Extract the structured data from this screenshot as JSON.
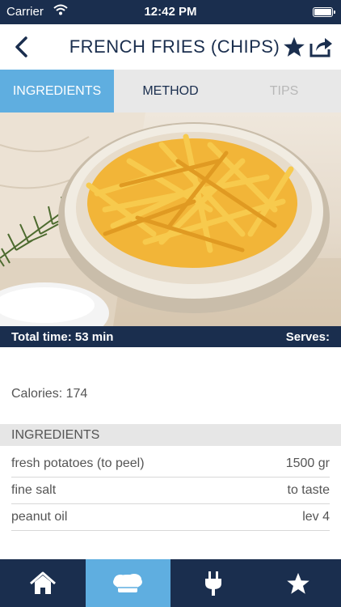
{
  "status": {
    "carrier": "Carrier",
    "time": "12:42 PM"
  },
  "nav": {
    "title": "FRENCH FRIES (CHIPS)"
  },
  "tabs": {
    "ingredients": "INGREDIENTS",
    "method": "METHOD",
    "tips": "TIPS"
  },
  "summary": {
    "total_time": "Total time: 53 min",
    "serves": "Serves:",
    "calories": "Calories: 174"
  },
  "ingredients_section": {
    "title": "INGREDIENTS",
    "items": [
      {
        "name": "fresh potatoes (to peel)",
        "qty": "1500 gr"
      },
      {
        "name": "fine salt",
        "qty": "to taste"
      },
      {
        "name": "peanut oil",
        "qty": "lev 4"
      }
    ]
  },
  "bottom_tabs": {
    "active": "recipes"
  },
  "colors": {
    "navy": "#1a2e4e",
    "accent": "#5faee0"
  }
}
